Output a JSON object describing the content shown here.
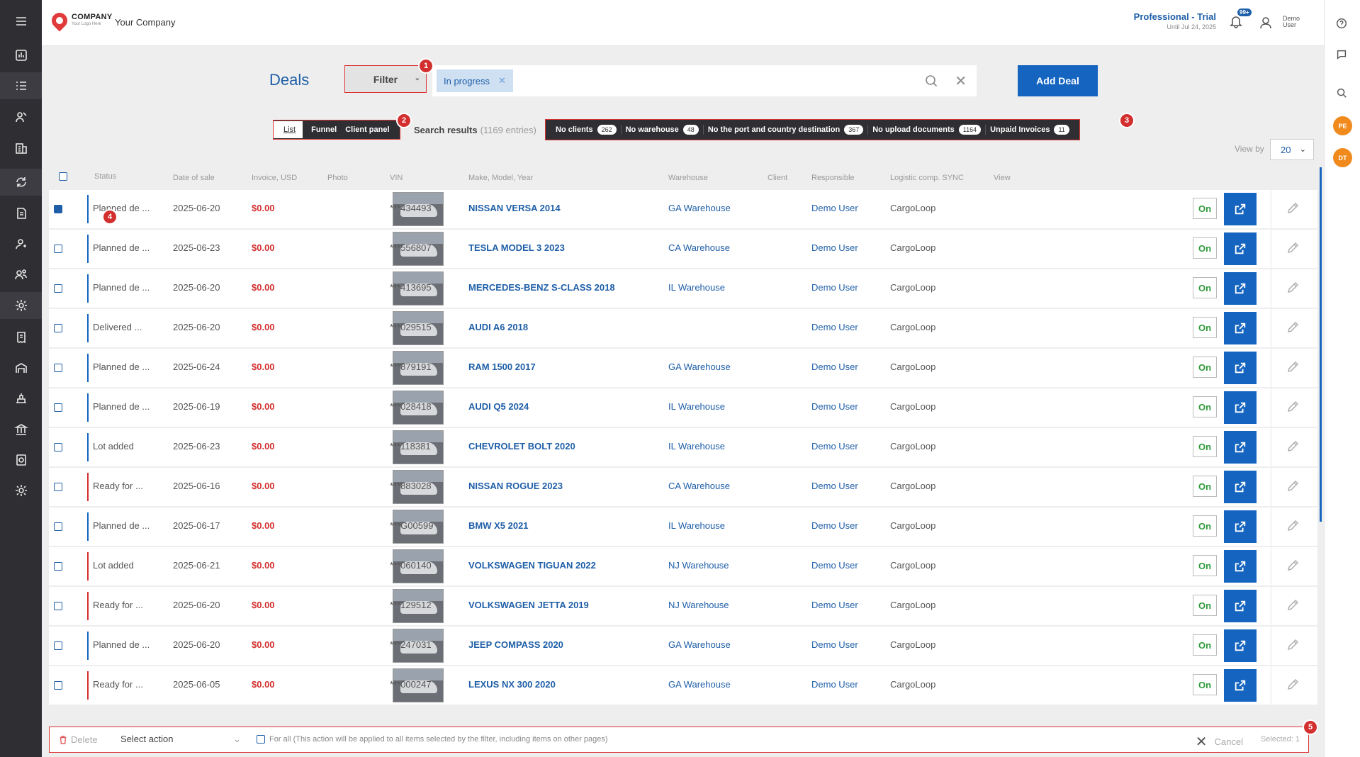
{
  "header": {
    "logo_top": "COMPANY",
    "logo_bottom": "Your Logo Here",
    "company": "Your Company",
    "plan": "Professional - Trial",
    "plan_until": "Until Jul 24, 2025",
    "notifications_badge": "99+",
    "user_line1": "Demo",
    "user_line2": "User"
  },
  "right_rail": {
    "avatar1": "PE",
    "avatar2": "DT"
  },
  "toolbar": {
    "title": "Deals",
    "filter_label": "Filter",
    "chip_label": "In progress",
    "add_deal": "Add Deal"
  },
  "views": {
    "list": "List",
    "funnel": "Funnel",
    "client_panel": "Client panel"
  },
  "search_results": {
    "label": "Search results",
    "count": "(1169 entries)"
  },
  "quick_filters": [
    {
      "label": "No clients",
      "count": "262"
    },
    {
      "label": "No warehouse",
      "count": "48"
    },
    {
      "label": "No the port and country destination",
      "count": "367"
    },
    {
      "label": "No upload documents",
      "count": "1164"
    },
    {
      "label": "Unpaid Invoices",
      "count": "11"
    }
  ],
  "view_by": {
    "label": "View by",
    "value": "20"
  },
  "markers": [
    "1",
    "2",
    "3",
    "4",
    "5"
  ],
  "table": {
    "headers": {
      "status": "Status",
      "date": "Date of sale",
      "invoice": "Invoice, USD",
      "photo": "Photo",
      "vin": "VIN",
      "make": "Make, Model, Year",
      "warehouse": "Warehouse",
      "client": "Client",
      "responsible": "Responsible",
      "logistic": "Logistic comp. SYNC",
      "view": "View"
    },
    "rows": [
      {
        "status": "Planned de ...",
        "date": "2025-06-20",
        "invoice": "$0.00",
        "vin": "***434493",
        "make": "NISSAN VERSA 2014",
        "warehouse": "GA Warehouse",
        "responsible": "Demo User",
        "logistic": "CargoLoop",
        "sync": "On",
        "color": "#1565c0",
        "checked": true
      },
      {
        "status": "Planned de ...",
        "date": "2025-06-23",
        "invoice": "$0.00",
        "vin": "***556807",
        "make": "TESLA MODEL 3 2023",
        "warehouse": "CA Warehouse",
        "responsible": "Demo User",
        "logistic": "CargoLoop",
        "sync": "On",
        "color": "#1565c0"
      },
      {
        "status": "Planned de ...",
        "date": "2025-06-20",
        "invoice": "$0.00",
        "vin": "***413695",
        "make": "MERCEDES-BENZ S-CLASS 2018",
        "warehouse": "IL Warehouse",
        "responsible": "Demo User",
        "logistic": "CargoLoop",
        "sync": "On",
        "color": "#1565c0"
      },
      {
        "status": "Delivered ...",
        "date": "2025-06-20",
        "invoice": "$0.00",
        "vin": "***029515",
        "make": "AUDI A6 2018",
        "warehouse": "",
        "responsible": "Demo User",
        "logistic": "CargoLoop",
        "sync": "On",
        "color": "#1565c0"
      },
      {
        "status": "Planned de ...",
        "date": "2025-06-24",
        "invoice": "$0.00",
        "vin": "***879191",
        "make": "RAM 1500 2017",
        "warehouse": "GA Warehouse",
        "responsible": "Demo User",
        "logistic": "CargoLoop",
        "sync": "On",
        "color": "#1565c0"
      },
      {
        "status": "Planned de ...",
        "date": "2025-06-19",
        "invoice": "$0.00",
        "vin": "***028418",
        "make": "AUDI Q5 2024",
        "warehouse": "IL Warehouse",
        "responsible": "Demo User",
        "logistic": "CargoLoop",
        "sync": "On",
        "color": "#1565c0"
      },
      {
        "status": "Lot added",
        "date": "2025-06-23",
        "invoice": "$0.00",
        "vin": "***118381",
        "make": "CHEVROLET BOLT 2020",
        "warehouse": "IL Warehouse",
        "responsible": "Demo User",
        "logistic": "CargoLoop",
        "sync": "On",
        "color": "#1565c0"
      },
      {
        "status": "Ready for ...",
        "date": "2025-06-16",
        "invoice": "$0.00",
        "vin": "***883028",
        "make": "NISSAN ROGUE 2023",
        "warehouse": "CA Warehouse",
        "responsible": "Demo User",
        "logistic": "CargoLoop",
        "sync": "On",
        "color": "#d32f2f"
      },
      {
        "status": "Planned de ...",
        "date": "2025-06-17",
        "invoice": "$0.00",
        "vin": "***G00599",
        "make": "BMW X5 2021",
        "warehouse": "IL Warehouse",
        "responsible": "Demo User",
        "logistic": "CargoLoop",
        "sync": "On",
        "color": "#1565c0"
      },
      {
        "status": "Lot added",
        "date": "2025-06-21",
        "invoice": "$0.00",
        "vin": "***060140",
        "make": "VOLKSWAGEN TIGUAN 2022",
        "warehouse": "NJ Warehouse",
        "responsible": "Demo User",
        "logistic": "CargoLoop",
        "sync": "On",
        "color": "#d32f2f"
      },
      {
        "status": "Ready for ...",
        "date": "2025-06-20",
        "invoice": "$0.00",
        "vin": "***129512",
        "make": "VOLKSWAGEN JETTA 2019",
        "warehouse": "NJ Warehouse",
        "responsible": "Demo User",
        "logistic": "CargoLoop",
        "sync": "On",
        "color": "#d32f2f"
      },
      {
        "status": "Planned de ...",
        "date": "2025-06-20",
        "invoice": "$0.00",
        "vin": "***247031",
        "make": "JEEP COMPASS 2020",
        "warehouse": "GA Warehouse",
        "responsible": "Demo User",
        "logistic": "CargoLoop",
        "sync": "On",
        "color": "#1565c0"
      },
      {
        "status": "Ready for ...",
        "date": "2025-06-05",
        "invoice": "$0.00",
        "vin": "***000247",
        "make": "LEXUS NX 300 2020",
        "warehouse": "GA Warehouse",
        "responsible": "Demo User",
        "logistic": "CargoLoop",
        "sync": "On",
        "color": "#d32f2f"
      }
    ]
  },
  "bottom_bar": {
    "delete": "Delete",
    "select_action": "Select action",
    "for_all": "For all (This action will be applied to all items selected by the filter, including items on other pages)",
    "cancel": "Cancel",
    "selected": "Selected: 1"
  }
}
